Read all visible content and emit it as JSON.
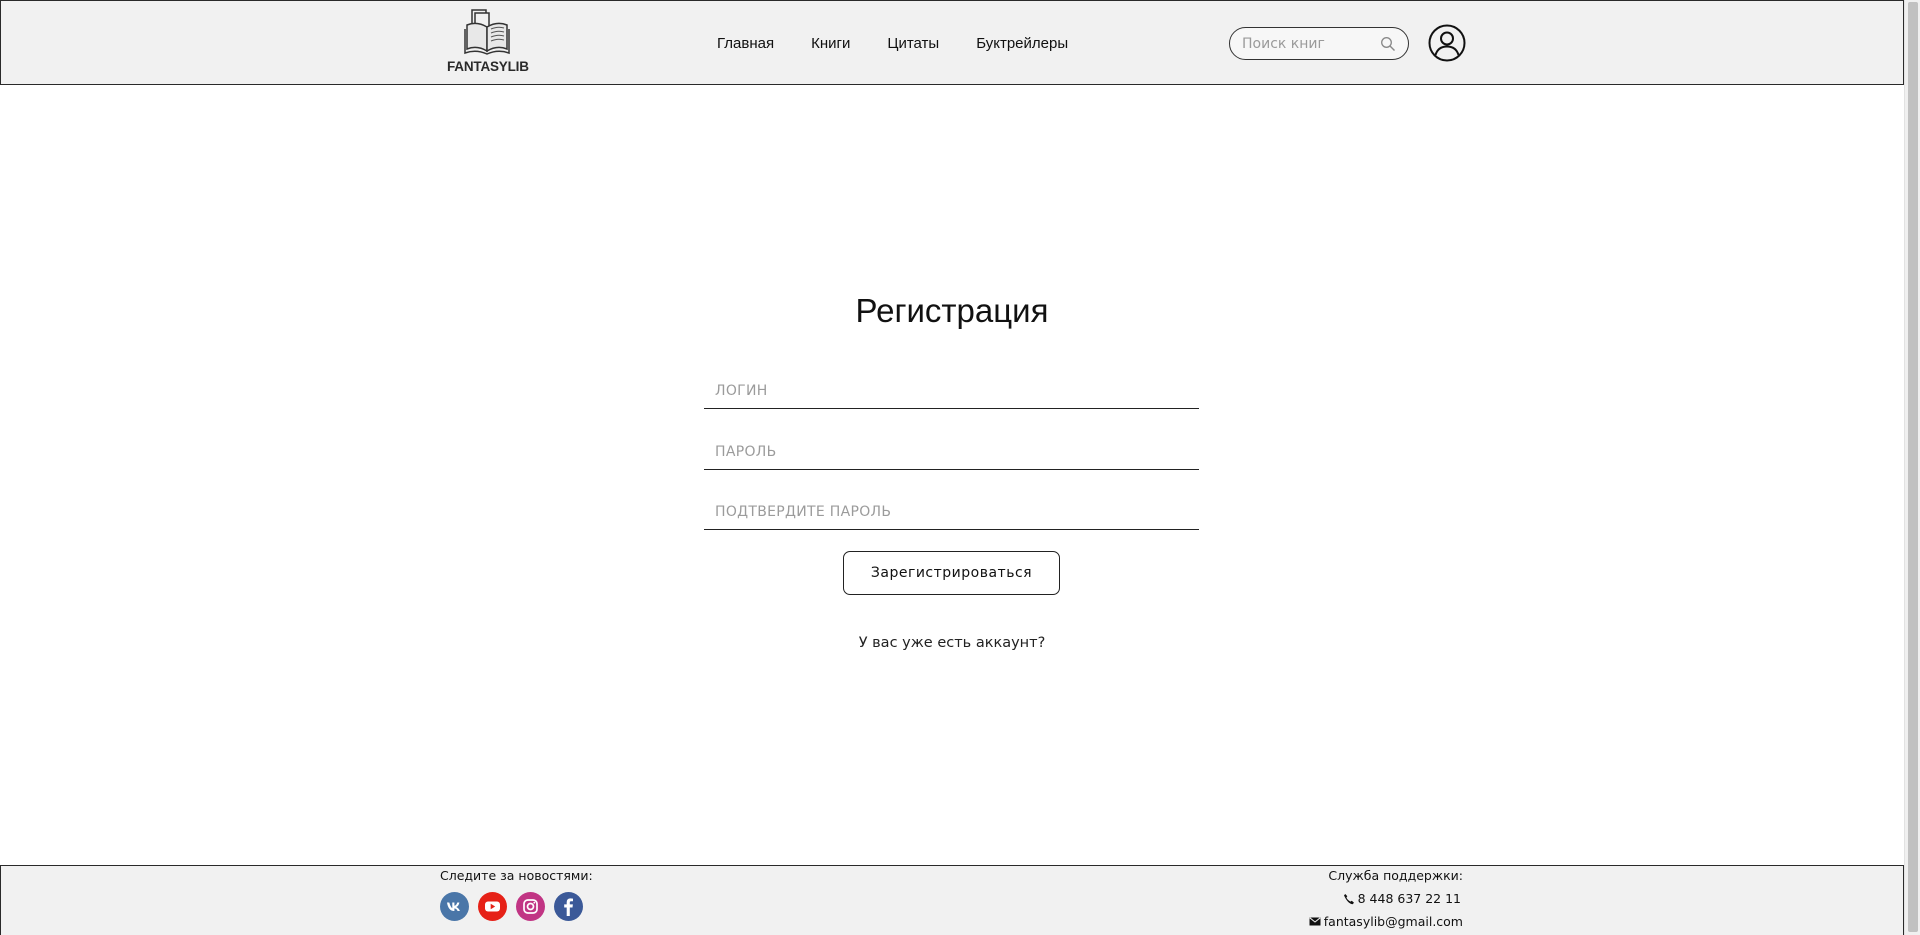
{
  "header": {
    "logo_text": "FANTASYLIB",
    "nav": [
      {
        "label": "Главная"
      },
      {
        "label": "Книги"
      },
      {
        "label": "Цитаты"
      },
      {
        "label": "Буктрейлеры"
      }
    ],
    "search": {
      "placeholder": "Поиск книг",
      "icon": "search-icon"
    },
    "user_icon": "user-icon"
  },
  "form": {
    "title": "Регистрация",
    "login_placeholder": "ЛОГИН",
    "password_placeholder": "ПАРОЛЬ",
    "confirm_placeholder": "ПОДТВЕРДИТЕ ПАРОЛЬ",
    "submit_label": "Зарегистрироваться",
    "login_link": "У вас уже есть аккаунт?"
  },
  "footer": {
    "follow_label": "Следите за новостями:",
    "socials": [
      {
        "name": "vk-icon",
        "color": "#4a76a8"
      },
      {
        "name": "youtube-icon",
        "color": "#e62117"
      },
      {
        "name": "instagram-icon",
        "color": "#c13584"
      },
      {
        "name": "facebook-icon",
        "color": "#3b5998"
      }
    ],
    "support_label": "Служба поддержки:",
    "phone": "8 448 637 22 11",
    "email": "fantasylib@gmail.com"
  }
}
